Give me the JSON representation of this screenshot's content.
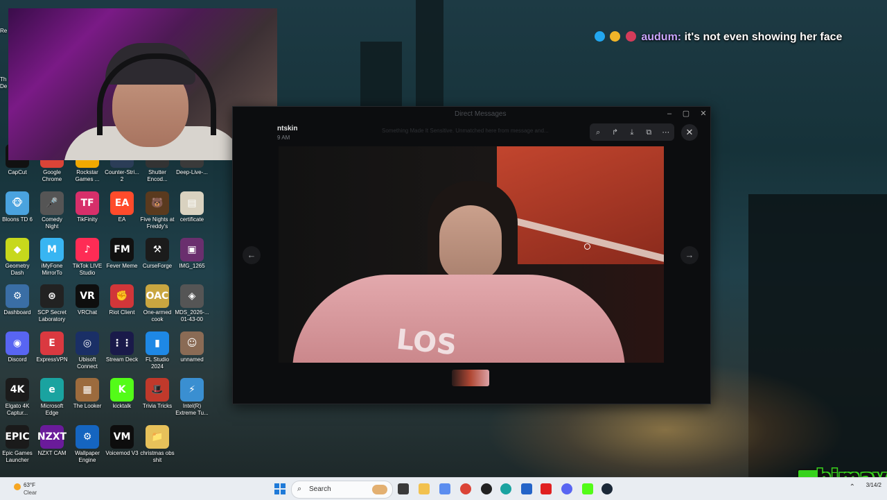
{
  "chat": {
    "username": "audum:",
    "message": "it's not even showing her face",
    "badge_colors": [
      "#22a7f0",
      "#f0b429",
      "#d43c5a"
    ]
  },
  "desktop_icons": [
    {
      "label": "CapCut",
      "glyph": "✂",
      "color": "#111111",
      "name": "capcut-icon"
    },
    {
      "label": "Google Chrome",
      "glyph": "●",
      "color": "#db4437",
      "name": "chrome-icon"
    },
    {
      "label": "Rockstar Games ...",
      "glyph": "R",
      "color": "#f2a900",
      "name": "rockstar-icon"
    },
    {
      "label": "Counter-Stri... 2",
      "glyph": "CS",
      "color": "#2b3d57",
      "name": "counter-strike-icon"
    },
    {
      "label": "Shutter Encod...",
      "glyph": "S",
      "color": "#333333",
      "name": "shutter-encoder-icon"
    },
    {
      "label": "Deep-Live-...",
      "glyph": "D",
      "color": "#3a3a3a",
      "name": "deep-live-icon"
    },
    {
      "label": "Bloons TD 6",
      "glyph": "🐵",
      "color": "#4aa3df",
      "name": "bloons-icon"
    },
    {
      "label": "Comedy Night",
      "glyph": "🎤",
      "color": "#555555",
      "name": "comedy-night-icon"
    },
    {
      "label": "TikFinity",
      "glyph": "TF",
      "color": "#d72f6a",
      "name": "tikfinity-icon"
    },
    {
      "label": "EA",
      "glyph": "EA",
      "color": "#ff4b2b",
      "name": "ea-icon"
    },
    {
      "label": "Five Nights at Freddy's",
      "glyph": "🐻",
      "color": "#5a3a1e",
      "name": "fnaf-icon"
    },
    {
      "label": "certificate",
      "glyph": "▤",
      "color": "#d9d2c0",
      "name": "certificate-icon"
    },
    {
      "label": "Geometry Dash",
      "glyph": "◆",
      "color": "#c7d81c",
      "name": "geometry-dash-icon"
    },
    {
      "label": "iMyFone MirrorTo",
      "glyph": "M",
      "color": "#38b5f2",
      "name": "mirrorto-icon"
    },
    {
      "label": "TikTok LIVE Studio",
      "glyph": "♪",
      "color": "#fe2c55",
      "name": "tiktok-live-icon"
    },
    {
      "label": "Fever Meme",
      "glyph": "FM",
      "color": "#111111",
      "name": "fever-meme-icon"
    },
    {
      "label": "CurseForge",
      "glyph": "⚒",
      "color": "#1b1b1b",
      "name": "curseforge-icon"
    },
    {
      "label": "IMG_1265",
      "glyph": "▣",
      "color": "#6a2f6e",
      "name": "image-file-icon"
    },
    {
      "label": "Dashboard",
      "glyph": "⚙",
      "color": "#3a6ea5",
      "name": "dashboard-icon"
    },
    {
      "label": "SCP Secret Laboratory",
      "glyph": "⊛",
      "color": "#222222",
      "name": "scp-icon"
    },
    {
      "label": "VRChat",
      "glyph": "VR",
      "color": "#0e0e0e",
      "name": "vrchat-icon"
    },
    {
      "label": "Riot Client",
      "glyph": "✊",
      "color": "#d13639",
      "name": "riot-client-icon"
    },
    {
      "label": "One-armed cook",
      "glyph": "OAC",
      "color": "#c9a640",
      "name": "one-armed-cook-icon"
    },
    {
      "label": "MDS_2026-... 01-43-00",
      "glyph": "◈",
      "color": "#555555",
      "name": "mds-file-icon"
    },
    {
      "label": "Discord",
      "glyph": "◉",
      "color": "#5865f2",
      "name": "discord-icon"
    },
    {
      "label": "ExpressVPN",
      "glyph": "E",
      "color": "#da3940",
      "name": "expressvpn-icon"
    },
    {
      "label": "Ubisoft Connect",
      "glyph": "◎",
      "color": "#1a2f66",
      "name": "ubisoft-icon"
    },
    {
      "label": "Stream Deck",
      "glyph": "⋮⋮",
      "color": "#1a1a4a",
      "name": "stream-deck-icon"
    },
    {
      "label": "FL Studio 2024",
      "glyph": "▮",
      "color": "#1e88e5",
      "name": "fl-studio-icon"
    },
    {
      "label": "unnamed",
      "glyph": "☺",
      "color": "#8a6b55",
      "name": "unnamed-image-icon"
    },
    {
      "label": "Elgato 4K Captur...",
      "glyph": "4K",
      "color": "#1b1b1b",
      "name": "elgato-icon"
    },
    {
      "label": "Microsoft Edge",
      "glyph": "e",
      "color": "#1aa3a0",
      "name": "edge-icon"
    },
    {
      "label": "The Looker",
      "glyph": "▦",
      "color": "#9c6b3d",
      "name": "the-looker-icon"
    },
    {
      "label": "kicktalk",
      "glyph": "K",
      "color": "#53fc18",
      "name": "kicktalk-icon"
    },
    {
      "label": "Trivia Tricks",
      "glyph": "🎩",
      "color": "#c0392b",
      "name": "trivia-tricks-icon"
    },
    {
      "label": "Intel(R) Extreme Tu...",
      "glyph": "⚡",
      "color": "#3a8fd1",
      "name": "intel-xtu-icon"
    },
    {
      "label": "Epic Games Launcher",
      "glyph": "EPIC",
      "color": "#1a1a1a",
      "name": "epic-games-icon"
    },
    {
      "label": "NZXT CAM",
      "glyph": "NZXT",
      "color": "#6a1b9a",
      "name": "nzxt-cam-icon"
    },
    {
      "label": "Wallpaper Engine",
      "glyph": "⚙",
      "color": "#1565c0",
      "name": "wallpaper-engine-icon"
    },
    {
      "label": "Voicemod V3",
      "glyph": "VM",
      "color": "#0d0d0d",
      "name": "voicemod-icon"
    },
    {
      "label": "christmas obs shit",
      "glyph": "📁",
      "color": "#e7c15a",
      "name": "folder-icon"
    }
  ],
  "partial_icons": [
    {
      "label": "Re"
    },
    {
      "label": "Th De"
    }
  ],
  "dm": {
    "window_title": "Direct Messages",
    "contact_name": "ntskin",
    "time": "9 AM",
    "notice": "Something Made It Sensitive. Unmatched here from message and..."
  },
  "viewer": {
    "tools": [
      "zoom-icon",
      "share-icon",
      "download-icon",
      "open-external-icon",
      "more-icon"
    ],
    "prev": "←",
    "next": "→",
    "close": "✕",
    "shirt_text": "LOS"
  },
  "brand": {
    "text": "himay"
  },
  "taskbar": {
    "temp": "63°F",
    "condition": "Clear",
    "search_placeholder": "Search",
    "date": "3/14/2"
  }
}
